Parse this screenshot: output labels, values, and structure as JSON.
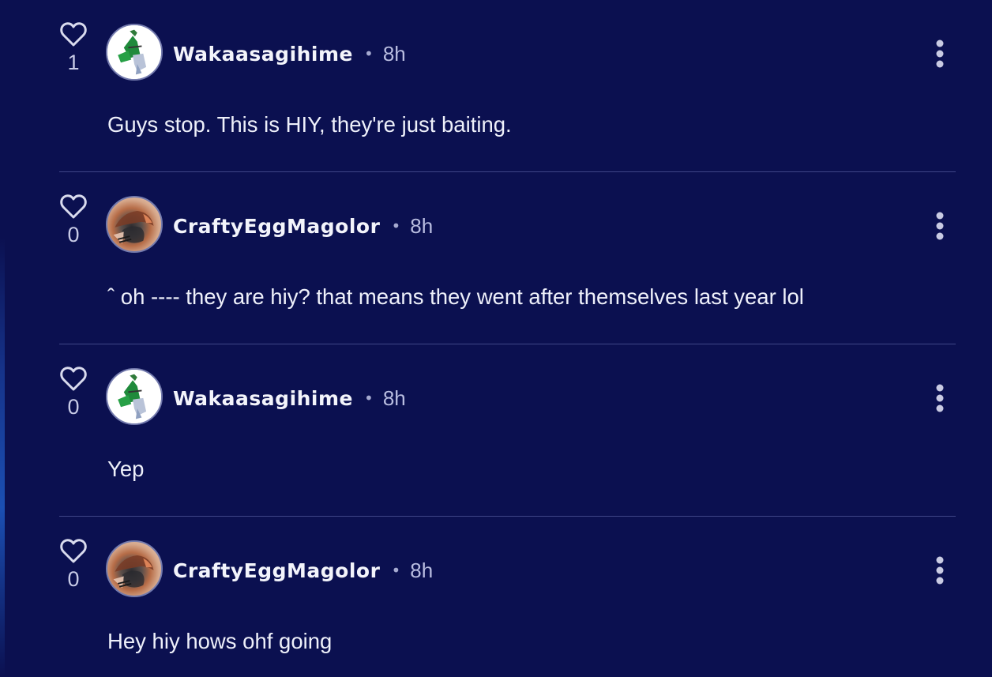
{
  "colors": {
    "background": "#0b1050",
    "divider": "#3f4687",
    "text": "#eef0fa",
    "muted": "#b9bde0"
  },
  "icons": {
    "like": "heart-outline",
    "menu": "vertical-ellipsis"
  },
  "separator": "•",
  "comments": [
    {
      "likes": "1",
      "username": "Wakaasagihime",
      "time": "8h",
      "text": "Guys stop. This is HIY, they're just baiting."
    },
    {
      "likes": "0",
      "username": "CraftyEggMagolor",
      "time": "8h",
      "text": "ˆ oh ---- they are hiy? that means they went after themselves last year lol"
    },
    {
      "likes": "0",
      "username": "Wakaasagihime",
      "time": "8h",
      "text": "Yep"
    },
    {
      "likes": "0",
      "username": "CraftyEggMagolor",
      "time": "8h",
      "text": "Hey hiy hows ohf going"
    }
  ]
}
